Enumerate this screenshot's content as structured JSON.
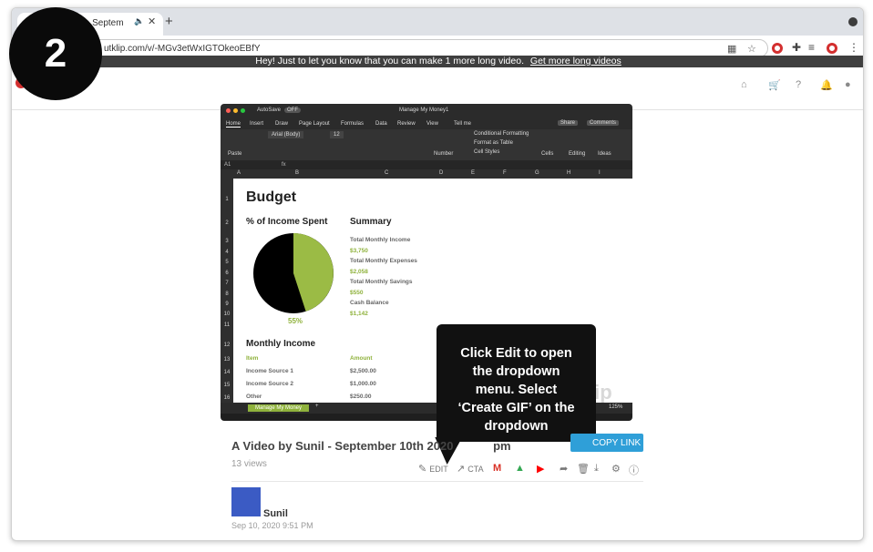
{
  "step": {
    "number": "2"
  },
  "browser": {
    "tab_title": "- Septem",
    "url": "utklip.com/v/-MGv3etWxIGTOkeoEBfY",
    "new_tab": "+",
    "tab_close": "✕",
    "tab_audio": "🔈"
  },
  "banner": {
    "text": "Hey! Just to let you know that you can make 1 more long video.",
    "link": "Get more long videos"
  },
  "excel": {
    "window_title": "Manage My Money1",
    "autosave": "AutoSave",
    "autosave_state": "OFF",
    "ribbon_tabs": [
      "Home",
      "Insert",
      "Draw",
      "Page Layout",
      "Formulas",
      "Data",
      "Review",
      "View"
    ],
    "tell_me": "Tell me",
    "share": "Share",
    "comments": "Comments",
    "font_name": "Arial (Body)",
    "font_size": "12",
    "paste": "Paste",
    "number": "Number",
    "cond_format": "Conditional Formatting",
    "format_table": "Format as Table",
    "cell_styles": "Cell Styles",
    "cells": "Cells",
    "editing": "Editing",
    "ideas": "Ideas",
    "name_box": "A1",
    "fx": "fx",
    "columns": [
      "A",
      "B",
      "C",
      "D",
      "E",
      "F",
      "G",
      "H",
      "I"
    ],
    "rows": [
      "1",
      "2",
      "3",
      "4",
      "5",
      "6",
      "7",
      "8",
      "9",
      "10",
      "11",
      "12",
      "13",
      "14",
      "15",
      "16"
    ],
    "budget": "Budget",
    "income_spent": "% of Income Spent",
    "summary": "Summary",
    "summary_items": [
      {
        "label": "Total Monthly Income",
        "value": "$3,750"
      },
      {
        "label": "Total Monthly Expenses",
        "value": "$2,058"
      },
      {
        "label": "Total Monthly Savings",
        "value": "$550"
      },
      {
        "label": "Cash Balance",
        "value": "$1,142"
      }
    ],
    "pie_percent": "55%",
    "monthly_income": "Monthly Income",
    "table_headers": [
      "Item",
      "Amount"
    ],
    "income_rows": [
      {
        "item": "Income Source 1",
        "amount": "$2,500.00"
      },
      {
        "item": "Income Source 2",
        "amount": "$1,000.00"
      },
      {
        "item": "Other",
        "amount": "$250.00"
      }
    ],
    "sheet_tab": "Manage My Money",
    "add_sheet": "+",
    "zoom": "125%",
    "watermark": "lip"
  },
  "tooltip": {
    "lines": [
      "Click Edit to open",
      "the dropdown",
      "menu. Select",
      "‘Create GIF’ on the",
      "dropdown"
    ]
  },
  "video": {
    "title": "A Video by Sunil - September 10th 2020",
    "title_suffix": "pm",
    "views": "13 views",
    "copy_link": "COPY LINK",
    "actions": {
      "edit": "EDIT",
      "cta": "CTA"
    }
  },
  "author": {
    "name": "Sunil",
    "date": "Sep 10, 2020 9:51 PM"
  },
  "colors": {
    "accent": "#2f9fd8",
    "excel_green": "#8fb23c",
    "banner": "#3f3f3f",
    "gmail_red": "#d93025",
    "youtube_red": "#ff0000"
  }
}
